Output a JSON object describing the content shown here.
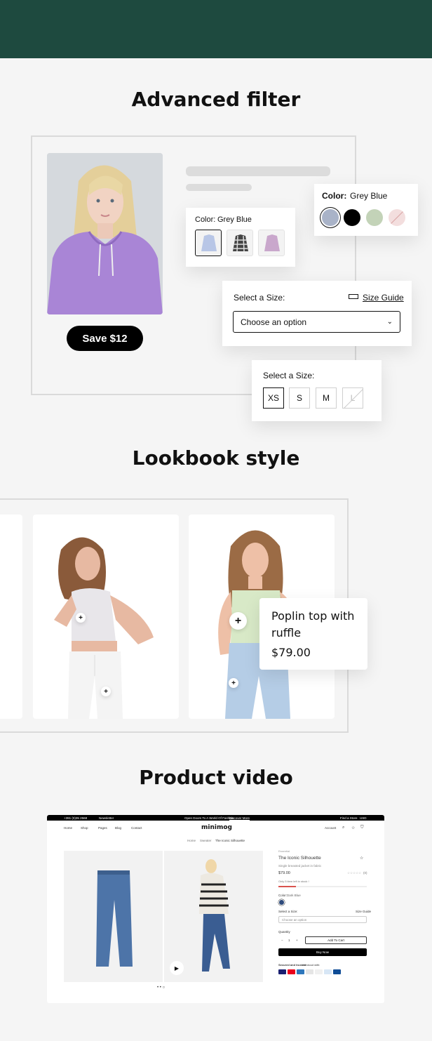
{
  "sections": {
    "filter_title": "Advanced filter",
    "lookbook_title": "Lookbook style",
    "video_title": "Product video"
  },
  "filter": {
    "save_button": "Save $12",
    "color_label": "Color:",
    "color_value": "Grey Blue",
    "size_label": "Select a Size:",
    "size_guide": "Size Guide",
    "select_placeholder": "Choose an option",
    "sizes": [
      "XS",
      "S",
      "M",
      "L"
    ],
    "swatch_colors": [
      "#a9b3c8",
      "#000000",
      "#c3d3b8",
      "#f3dede"
    ]
  },
  "lookbook": {
    "product_name": "Poplin top with ruffle",
    "product_price": "$79.00"
  },
  "store": {
    "phone": "+391 (0)35 2568",
    "newsletter": "Newsletter",
    "announcement": "Open Doors To A World Of Fashion",
    "discover": "Discover More",
    "find_store": "Find a Store",
    "currency": "USD",
    "brand": "minimog",
    "nav": [
      "Home",
      "Shop",
      "Pages",
      "Blog",
      "Contact"
    ],
    "account": "Account",
    "breadcrumb": [
      "Home",
      "Sweater",
      "The Iconic Silhouette"
    ],
    "product_vendor": "Essential",
    "product_title": "The Iconic Silhouette",
    "product_sub": "Single breasted jacket in fabric",
    "price": "$79.00",
    "review_count": "(0)",
    "stock_note": "Only 5 item left in stock !",
    "color_label": "Color:",
    "color_value": "Dark Blue",
    "size_label": "Select a Size:",
    "size_guide": "Size Guide",
    "size_placeholder": "Choose an option",
    "quantity_label": "Quantity",
    "qty_minus": "−",
    "qty_value": "1",
    "qty_plus": "+",
    "add_to_cart": "Add To Cart",
    "buy_now": "Buy Now",
    "secure_label": "Secured and trusted",
    "secure_rest": "checkout with:"
  }
}
